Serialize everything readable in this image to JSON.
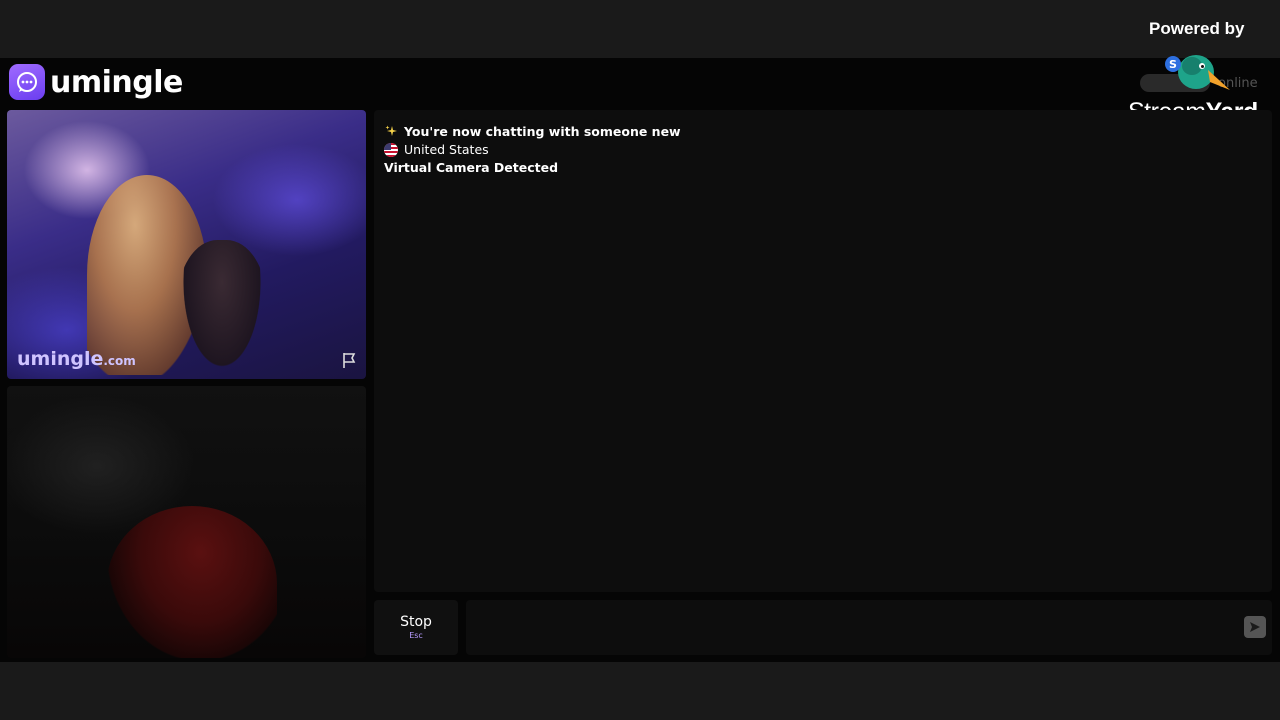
{
  "brand": {
    "name": "umingle"
  },
  "header": {
    "online_label": "online"
  },
  "overlay": {
    "powered_by": "Powered by",
    "brand_stream": "Stream",
    "brand_yard": "Yard"
  },
  "video_top": {
    "watermark": "umingle",
    "watermark_suffix": ".com"
  },
  "chat": {
    "messages": [
      {
        "icon": "sparkles-icon",
        "text": "You're now chatting with someone new",
        "bold": true
      },
      {
        "icon": "us-flag-icon",
        "text": "United States",
        "bold": false
      },
      {
        "icon": "",
        "text": "Virtual Camera Detected",
        "bold": true
      }
    ]
  },
  "controls": {
    "stop_label": "Stop",
    "stop_shortcut": "Esc",
    "input_value": "",
    "send_icon": "send-icon"
  },
  "colors": {
    "accent": "#7b4dff",
    "background": "#050505",
    "panel": "#0d0d0d"
  }
}
